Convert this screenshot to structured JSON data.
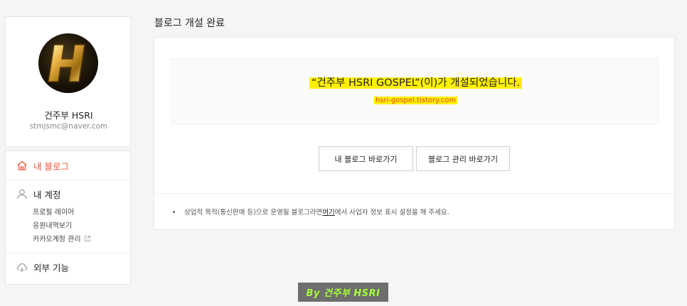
{
  "profile": {
    "name": "건주부 HSRI",
    "email": "stmjsmc@naver.com"
  },
  "menu": {
    "my_blog": "내 블로그",
    "my_account": "내 계정",
    "account_items": [
      "프로필 레이어",
      "응원내역보기",
      "카카오계정 관리"
    ],
    "external": "외부 기능"
  },
  "main": {
    "title": "블로그 개설 완료",
    "created_message": "“건주부 HSRI GOSPEL”(이)가 개설되었습니다.",
    "blog_url": "hsri-gospel.tistory.com",
    "btn_my_blog": "내 블로그 바로가기",
    "btn_manage_blog": "블로그 관리 바로가기",
    "footer_pre": "상업적 목적(통신판매 등)으로 운영될 블로그라면 ",
    "footer_link": "여기",
    "footer_post": "에서 사업자 정보 표시 설정을 해 주세요."
  },
  "watermark": "By 건주부 HSRI",
  "colors": {
    "accent": "#f04e3a",
    "highlight": "#fff000",
    "watermark_text": "#a6ff3a"
  }
}
